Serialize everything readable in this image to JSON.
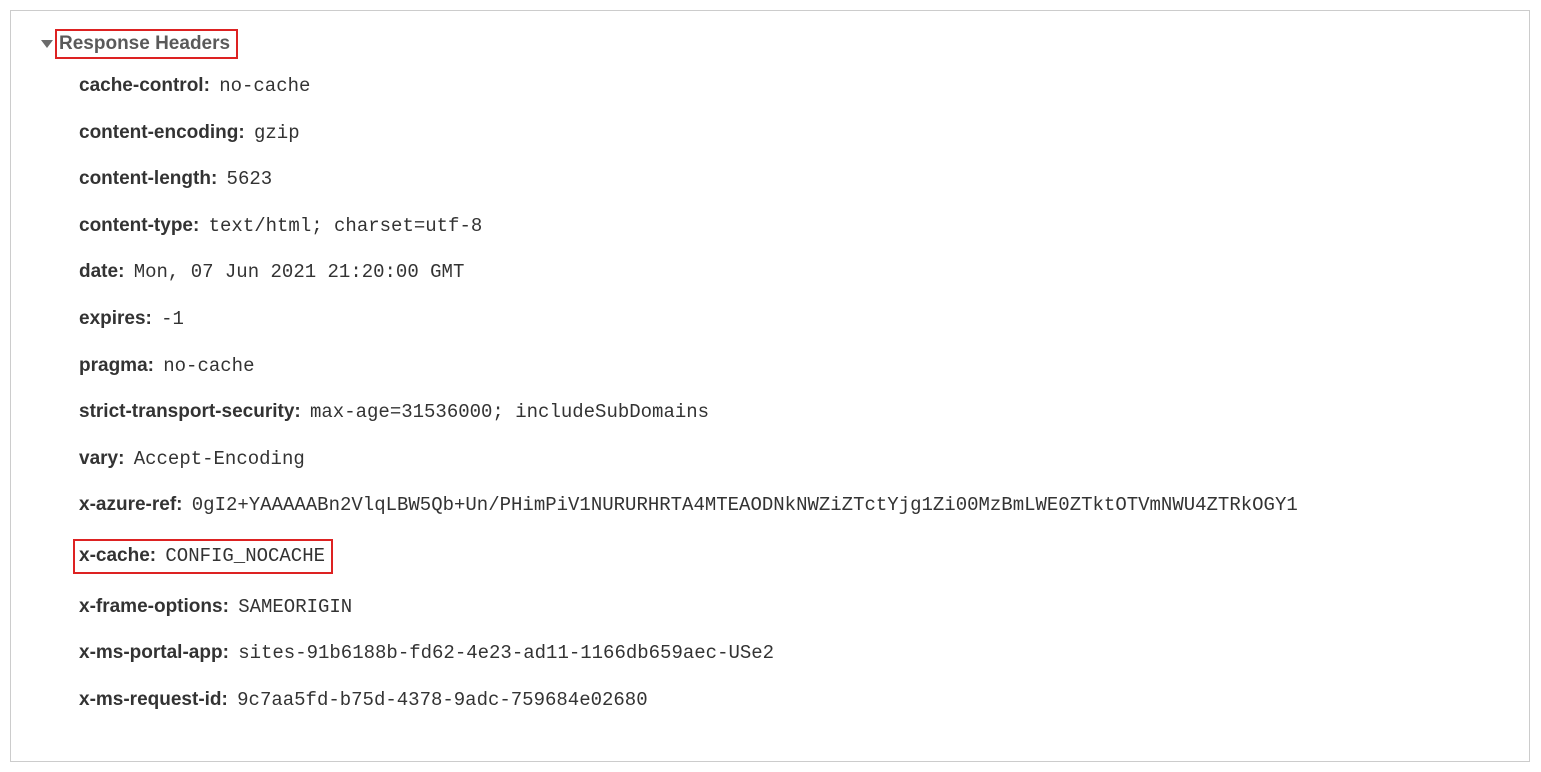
{
  "section": {
    "title": "Response Headers"
  },
  "headers": {
    "cache_control": {
      "name": "cache-control",
      "value": "no-cache"
    },
    "content_encoding": {
      "name": "content-encoding",
      "value": "gzip"
    },
    "content_length": {
      "name": "content-length",
      "value": "5623"
    },
    "content_type": {
      "name": "content-type",
      "value": "text/html; charset=utf-8"
    },
    "date": {
      "name": "date",
      "value": "Mon, 07 Jun 2021 21:20:00 GMT"
    },
    "expires": {
      "name": "expires",
      "value": "-1"
    },
    "pragma": {
      "name": "pragma",
      "value": "no-cache"
    },
    "strict_transport_security": {
      "name": "strict-transport-security",
      "value": "max-age=31536000; includeSubDomains"
    },
    "vary": {
      "name": "vary",
      "value": "Accept-Encoding"
    },
    "x_azure_ref": {
      "name": "x-azure-ref",
      "value": "0gI2+YAAAAABn2VlqLBW5Qb+Un/PHimPiV1NURURHRTA4MTEAODNkNWZiZTctYjg1Zi00MzBmLWE0ZTktOTVmNWU4ZTRkOGY1"
    },
    "x_cache": {
      "name": "x-cache",
      "value": "CONFIG_NOCACHE"
    },
    "x_frame_options": {
      "name": "x-frame-options",
      "value": "SAMEORIGIN"
    },
    "x_ms_portal_app": {
      "name": "x-ms-portal-app",
      "value": "sites-91b6188b-fd62-4e23-ad11-1166db659aec-USe2"
    },
    "x_ms_request_id": {
      "name": "x-ms-request-id",
      "value": "9c7aa5fd-b75d-4378-9adc-759684e02680"
    }
  },
  "highlight": {
    "section_title": true,
    "x_cache_row": true
  },
  "colors": {
    "highlight_border": "#d22",
    "panel_border": "#ccc",
    "text": "#333",
    "title_text": "#5a5a5a"
  }
}
